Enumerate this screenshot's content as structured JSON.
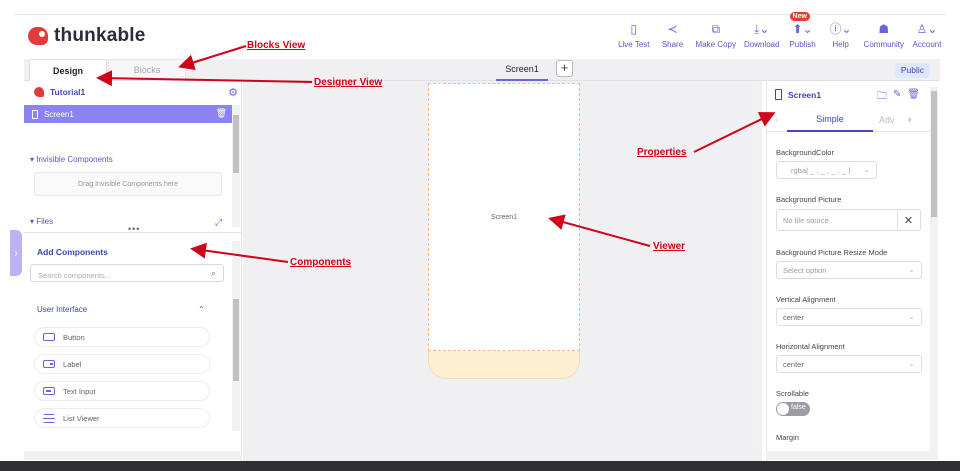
{
  "app": {
    "logo_text": "thunkable"
  },
  "menu": [
    {
      "label": "Live Test",
      "icon": "phone-icon",
      "glyph": "▯"
    },
    {
      "label": "Share",
      "icon": "share-icon",
      "glyph": "≺"
    },
    {
      "label": "Make Copy",
      "icon": "copy-icon",
      "glyph": "⧉"
    },
    {
      "label": "Download",
      "icon": "download-icon",
      "glyph": "⤓⌄"
    },
    {
      "label": "Publish",
      "icon": "publish-icon",
      "glyph": "⬆⌄",
      "badge": "New"
    },
    {
      "label": "Help",
      "icon": "info-icon",
      "glyph": "ⓘ⌄"
    },
    {
      "label": "Community",
      "icon": "community-icon",
      "glyph": "☗"
    },
    {
      "label": "Account",
      "icon": "account-icon",
      "glyph": "♙⌄"
    }
  ],
  "tabs": {
    "design": "Design",
    "blocks": "Blocks"
  },
  "screen_tab": "Screen1",
  "add_screen": "+",
  "public_label": "Public",
  "left": {
    "project_name": "Tutorial1",
    "screen_item": "Screen1",
    "invisible_heading": "▾ Invisible Components",
    "invisible_drop": "Drag Invisible Components here",
    "files_heading": "▾ Files",
    "add_components": "Add Components",
    "search_placeholder": "Search components...",
    "category": "User Interface",
    "components": [
      "Button",
      "Label",
      "Text Input",
      "List Viewer"
    ]
  },
  "canvas": {
    "screen_label": "Screen1"
  },
  "right": {
    "title": "Screen1",
    "tab_simple": "Simple",
    "tab_advanced": "Adv",
    "props": {
      "background_color_label": "BackgroundColor",
      "background_color_value": "rgba( _ , _ , _ , _ )",
      "background_picture_label": "Background Picture",
      "background_picture_value": "No file source",
      "resize_mode_label": "Background Picture Resize Mode",
      "resize_mode_value": "Select option",
      "vertical_alignment_label": "Vertical Alignment",
      "vertical_alignment_value": "center",
      "horizontal_alignment_label": "Horizontal Alignment",
      "horizontal_alignment_value": "center",
      "scrollable_label": "Scrollable",
      "scrollable_value": "false",
      "margin_label": "Margin"
    }
  },
  "annotations": {
    "blocks_view": "Blocks View",
    "designer_view": "Designer View",
    "properties": "Properties",
    "viewer": "Viewer",
    "components": "Components"
  },
  "colors": {
    "accent": "#6c63d6",
    "selected": "#8b84f0",
    "annotation": "#d0021b",
    "brand": "#e23b3b"
  }
}
